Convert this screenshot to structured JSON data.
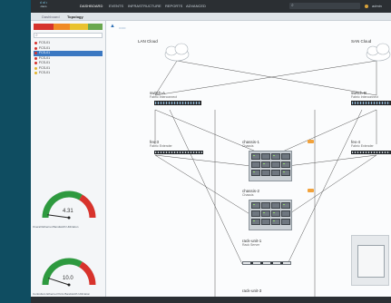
{
  "app": {
    "brand": "cisco",
    "nav": [
      "DASHBOARD",
      "EVENTS",
      "INFRASTRUCTURE",
      "REPORTS",
      "ADVANCED"
    ],
    "user": "admin"
  },
  "tabs": [
    "Dashboard",
    "Topology"
  ],
  "left_panel": {
    "fault_summary_colors": [
      "#d6332c",
      "#f08a24",
      "#e9c22e",
      "#6aa84f"
    ],
    "alerts": [
      {
        "label": "FCS-01",
        "severity": "crit"
      },
      {
        "label": "FCS-01",
        "severity": "crit"
      },
      {
        "label": "FCS-01",
        "severity": "crit",
        "selected": true
      },
      {
        "label": "FCS-01",
        "severity": "crit"
      },
      {
        "label": "FCS-01",
        "severity": "crit"
      },
      {
        "label": "FCS-01",
        "severity": "warn"
      },
      {
        "label": "FCS-01",
        "severity": "warn"
      }
    ],
    "gauges": [
      {
        "value_text": "4.31",
        "value": 4.31,
        "max": 100,
        "caption": "Overall Ethernet Bandwidth Utilization"
      },
      {
        "value_text": "10.0",
        "value": 10.0,
        "max": 100,
        "caption": "Controllers Ethernet Ports Bandwidth Utilization"
      }
    ]
  },
  "topology": {
    "lan_cloud": "LAN Cloud",
    "san_cloud": "SAN Cloud",
    "switch_a": {
      "name": "switch-A",
      "role": "Fabric Interconnect"
    },
    "switch_b": {
      "name": "switch-B",
      "role": "Fabric Interconnect"
    },
    "fex_left": {
      "name": "fex-3",
      "role": "Fabric Extender"
    },
    "fex_right": {
      "name": "fex-4",
      "role": "Fabric Extender"
    },
    "chassis_1": {
      "name": "chassis-1",
      "role": "Chassis"
    },
    "chassis_2": {
      "name": "chassis-2",
      "role": "Chassis"
    },
    "rack_1": {
      "name": "rack-unit-1",
      "role": "Rack Server"
    },
    "rack_3": {
      "name": "rack-unit-3"
    },
    "badge_color": "#f2a23b"
  }
}
